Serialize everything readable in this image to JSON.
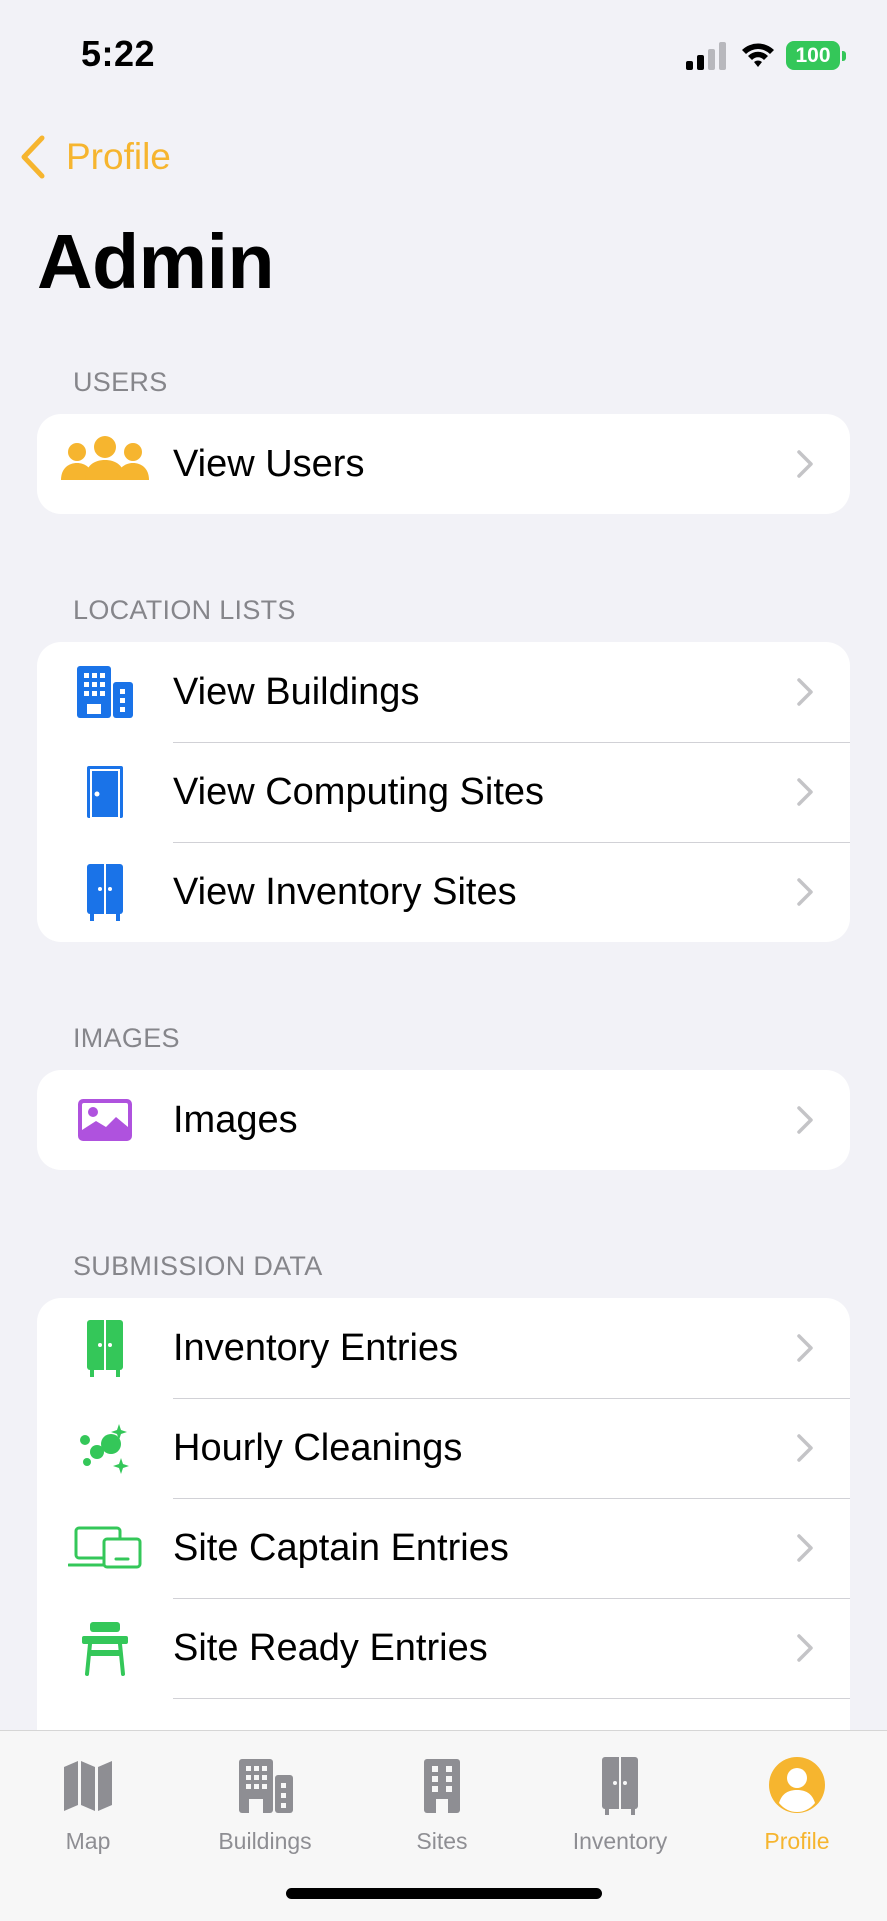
{
  "status_bar": {
    "time": "5:22",
    "battery_level": "100"
  },
  "nav": {
    "back_label": "Profile",
    "title": "Admin"
  },
  "sections": {
    "users": {
      "header": "USERS",
      "items": [
        {
          "label": "View Users",
          "icon": "users-icon"
        }
      ]
    },
    "location_lists": {
      "header": "LOCATION LISTS",
      "items": [
        {
          "label": "View Buildings",
          "icon": "building-icon"
        },
        {
          "label": "View Computing Sites",
          "icon": "door-icon"
        },
        {
          "label": "View Inventory Sites",
          "icon": "cabinet-icon"
        }
      ]
    },
    "images": {
      "header": "IMAGES",
      "items": [
        {
          "label": "Images",
          "icon": "photo-icon"
        }
      ]
    },
    "submission_data": {
      "header": "SUBMISSION DATA",
      "items": [
        {
          "label": "Inventory Entries",
          "icon": "cabinet-icon"
        },
        {
          "label": "Hourly Cleanings",
          "icon": "sparkles-icon"
        },
        {
          "label": "Site Captain Entries",
          "icon": "devices-icon"
        },
        {
          "label": "Site Ready Entries",
          "icon": "desk-icon"
        }
      ]
    }
  },
  "tabs": [
    {
      "label": "Map",
      "icon": "map-icon"
    },
    {
      "label": "Buildings",
      "icon": "building-icon"
    },
    {
      "label": "Sites",
      "icon": "sites-icon"
    },
    {
      "label": "Inventory",
      "icon": "cabinet-icon"
    },
    {
      "label": "Profile",
      "icon": "person-icon",
      "active": true
    }
  ],
  "colors": {
    "accent": "#f6b52f",
    "blue": "#1a73e8",
    "purple": "#af52de",
    "green": "#34c759",
    "gray_icon": "#8e8e93"
  }
}
